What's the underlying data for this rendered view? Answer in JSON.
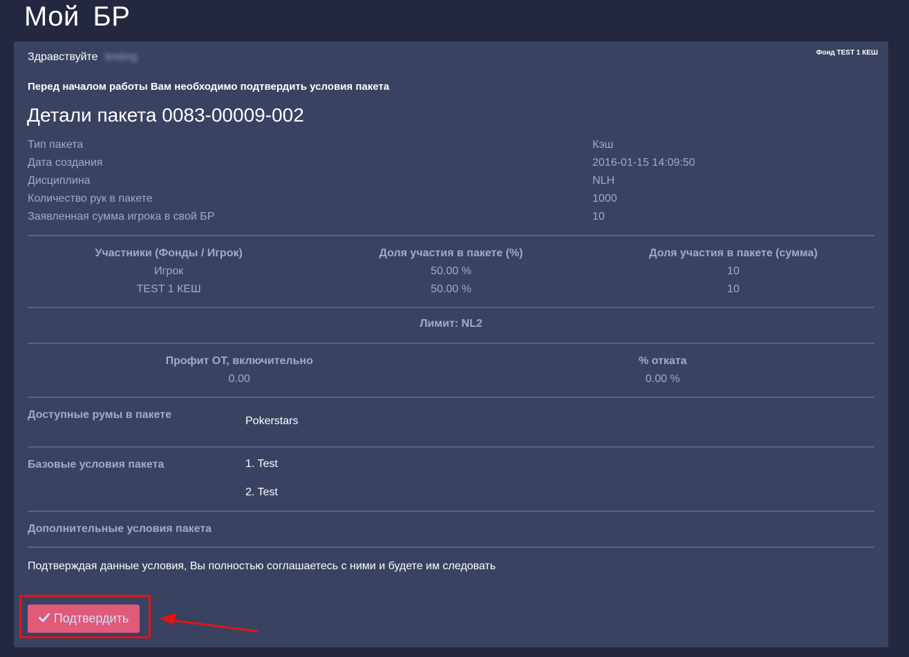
{
  "app": {
    "title": "Мой  БР"
  },
  "panel": {
    "greeting_label": "Здравствуйте",
    "username": "testing",
    "fund_label": "Фонд TEST 1 КЕШ",
    "notice": "Перед началом работы Вам необходимо подтвердить условия пакета",
    "package_title": "Детали пакета 0083-00009-002"
  },
  "details": [
    {
      "label": "Тип пакета",
      "value": "Кэш"
    },
    {
      "label": "Дата создания",
      "value": "2016-01-15 14:09:50"
    },
    {
      "label": "Дисциплина",
      "value": "NLH"
    },
    {
      "label": "Количество рук в пакете",
      "value": "1000"
    },
    {
      "label": "Заявленная сумма игрока в свой БР",
      "value": "10"
    }
  ],
  "participants": {
    "headers": [
      "Участники (Фонды / Игрок)",
      "Доля участия в пакете (%)",
      "Доля участия в пакете (сумма)"
    ],
    "rows": [
      [
        "Игрок",
        "50.00 %",
        "10"
      ],
      [
        "TEST 1 КЕШ",
        "50.00 %",
        "10"
      ]
    ]
  },
  "limit": "Лимит: NL2",
  "profit": {
    "headers": [
      "Профит ОТ, включительно",
      "% отката"
    ],
    "values": [
      "0.00",
      "0.00 %"
    ]
  },
  "rooms": {
    "label": "Доступные румы в пакете",
    "value": "Pokerstars"
  },
  "base_conditions": {
    "label": "Базовые условия пакета",
    "items": [
      "1. Test",
      "2. Test"
    ]
  },
  "extra_conditions": {
    "label": "Дополнительные условия пакета"
  },
  "confirm": {
    "text": "Подтверждая данные условия, Вы полностью соглашаетесь с ними и будете им следовать",
    "button_label": "Подтвердить",
    "button_icon": "check-icon"
  },
  "colors": {
    "background": "#232840",
    "panel": "#394261",
    "muted_text": "#a3aac4",
    "button": "#e05a7a",
    "annotation": "#e31414"
  }
}
